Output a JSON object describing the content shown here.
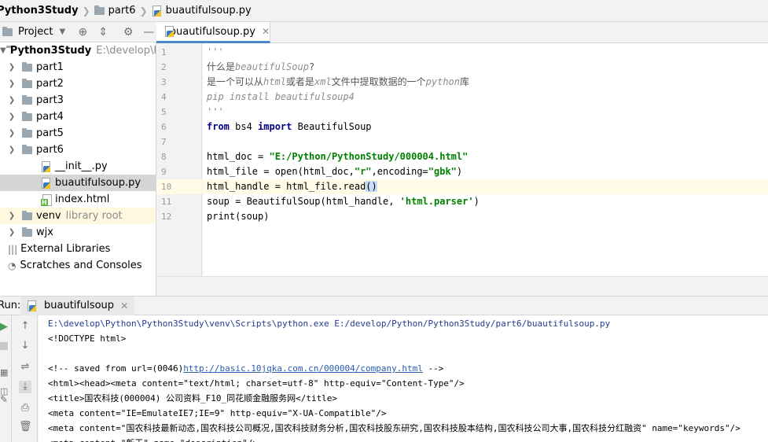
{
  "breadcrumb": {
    "project": "Python3Study",
    "folder": "part6",
    "file": "buautifulsoup.py"
  },
  "project_panel": {
    "title": "Project",
    "root_name": "Python3Study",
    "root_path": "E:\\develop\\Py",
    "items": [
      {
        "label": "part1"
      },
      {
        "label": "part2"
      },
      {
        "label": "part3"
      },
      {
        "label": "part4"
      },
      {
        "label": "part5"
      },
      {
        "label": "part6"
      },
      {
        "label": "__init__.py"
      },
      {
        "label": "buautifulsoup.py"
      },
      {
        "label": "index.html"
      },
      {
        "label": "venv",
        "hint": "library root"
      },
      {
        "label": "wjx"
      },
      {
        "label": "External Libraries"
      },
      {
        "label": "Scratches and Consoles"
      }
    ]
  },
  "editor": {
    "tab_label": "buautifulsoup.py",
    "line_numbers": [
      "1",
      "2",
      "3",
      "4",
      "5",
      "6",
      "7",
      "8",
      "9",
      "10",
      "11",
      "12"
    ],
    "lines": {
      "l1": "'''",
      "l2a": "什么是",
      "l2b": "beautifulSoup",
      "l2c": "?",
      "l3a": "是一个可以从",
      "l3b": "html",
      "l3c": "或者是",
      "l3d": "xml",
      "l3e": "文件中提取数据的一个",
      "l3f": "python",
      "l3g": "库",
      "l4": "pip install beautifulsoup4",
      "l5": "'''",
      "l6a": "from",
      "l6b": " bs4 ",
      "l6c": "import",
      "l6d": " BeautifulSoup",
      "l8a": "html_doc = ",
      "l8b": "\"E:/Python/PythonStudy/000004.html\"",
      "l9a": "html_file = open(html_doc,",
      "l9b": "\"r\"",
      "l9c": ",encoding=",
      "l9d": "\"gbk\"",
      "l9e": ")",
      "l10a": "html_handle = html_file.read",
      "l10b": "()",
      "l11a": "soup = BeautifulSoup(html_handle, ",
      "l11b": "'html.parser'",
      "l11c": ")",
      "l12": "print(soup)"
    }
  },
  "run_panel": {
    "label": "Run:",
    "tab_label": "buautifulsoup",
    "console": {
      "cmd": "E:\\develop\\Python\\Python3Study\\venv\\Scripts\\python.exe E:/develop/Python/Python3Study/part6/buautifulsoup.py",
      "c2": "<!DOCTYPE html>",
      "c4a": "<!-- saved from url=(0046)",
      "c4b": "http://basic.10jqka.com.cn/000004/company.html",
      "c4c": " -->",
      "c5": "<html><head><meta content=\"text/html; charset=utf-8\" http-equiv=\"Content-Type\"/>",
      "c6": "<title>国农科技(000004) 公司资料_F10_同花顺金融服务网</title>",
      "c7": "<meta content=\"IE=EmulateIE7;IE=9\" http-equiv=\"X-UA-Compatible\"/>",
      "c8": "<meta content=\"国农科技最新动态,国农科技公司概况,国农科技财务分析,国农科技股东研究,国农科技股本结构,国农科技公司大事,国农科技分红融资\" name=\"keywords\"/>",
      "c9": "<meta content=\"新王\" name=\"description\"/>"
    }
  }
}
